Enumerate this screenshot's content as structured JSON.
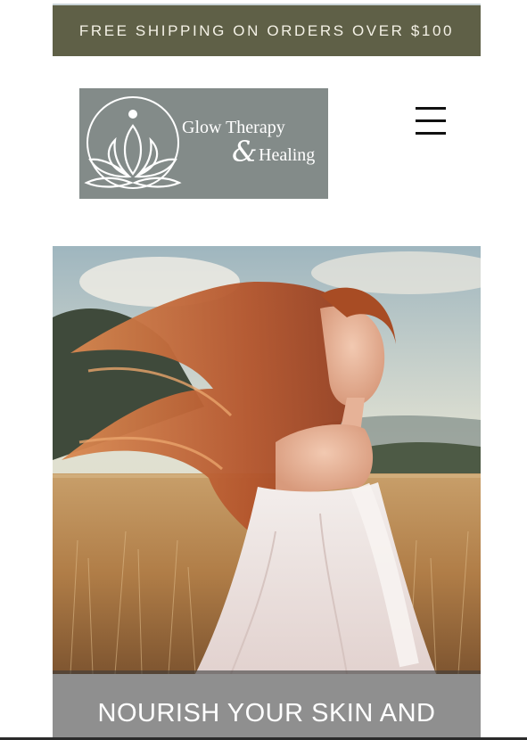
{
  "announcement": {
    "text": "FREE SHIPPING ON ORDERS OVER $100"
  },
  "logo": {
    "line1": "Glow Therapy",
    "ampersand": "&",
    "line2": "Healing"
  },
  "header": {
    "menu_icon": "hamburger-menu-icon"
  },
  "hero": {
    "image_subject": "woman with flowing red hair in white dress in golden field",
    "caption": "NOURISH YOUR SKIN AND"
  },
  "colors": {
    "announcement_bg": "#5f6047",
    "logo_bg": "#838b89",
    "caption_bg": "#8f8f8f"
  }
}
